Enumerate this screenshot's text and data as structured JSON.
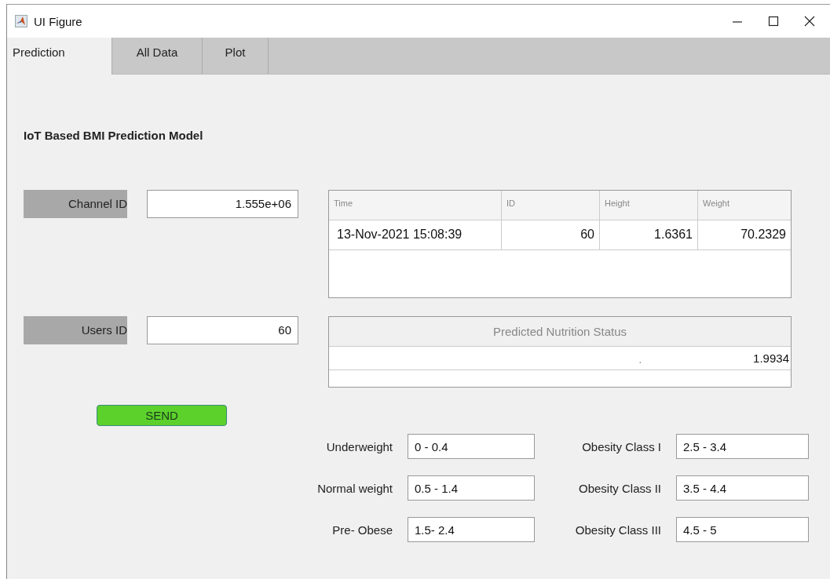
{
  "window": {
    "title": "UI Figure"
  },
  "tabs": [
    {
      "label": "Prediction",
      "selected": true
    },
    {
      "label": "All Data",
      "selected": false
    },
    {
      "label": "Plot",
      "selected": false
    }
  ],
  "heading": "IoT Based BMI Prediction Model",
  "inputs": [
    {
      "label": "Channel ID",
      "value": "1.555e+06"
    },
    {
      "label": "Users ID",
      "value": "60"
    }
  ],
  "data_table": {
    "columns": [
      "Time",
      "ID",
      "Height",
      "Weight"
    ],
    "rows": [
      [
        "13-Nov-2021 15:08:39",
        "60",
        "1.6361",
        "70.2329"
      ]
    ]
  },
  "status_table": {
    "title": "Predicted Nutrition Status",
    "rows": [
      [
        ".",
        "1.9934"
      ]
    ]
  },
  "send_button": "SEND",
  "ranges": [
    {
      "label": "Underweight",
      "value": "0 - 0.4"
    },
    {
      "label": "Obesity Class I",
      "value": "2.5 - 3.4"
    },
    {
      "label": "Normal weight",
      "value": "0.5 - 1.4"
    },
    {
      "label": "Obesity Class II",
      "value": "3.5 - 4.4"
    },
    {
      "label": "Pre- Obese",
      "value": "1.5- 2.4"
    },
    {
      "label": "Obesity Class III",
      "value": "4.5 - 5"
    }
  ]
}
